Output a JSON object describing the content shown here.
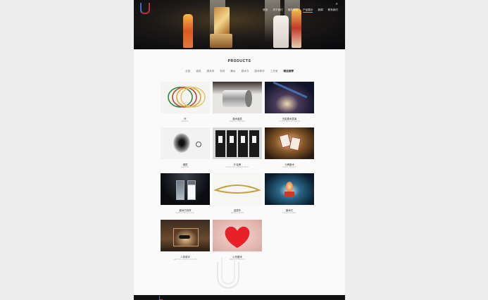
{
  "nav": {
    "items": [
      "首页",
      "关于我们",
      "服务项目",
      "产品展示",
      "新闻",
      "联系我们"
    ],
    "active_index": 3
  },
  "products": {
    "title": "PRODUCTS",
    "filters": [
      "全部",
      "道具",
      "魔术师",
      "特效",
      "舞台",
      "魔术书",
      "魔术教学",
      "工作室",
      "精选推荐"
    ],
    "active_filter_index": 8,
    "items": [
      {
        "name": "环",
        "sub": "RINGS",
        "thumb": "rings"
      },
      {
        "name": "魔术道具",
        "sub": "MAGIC PROPS",
        "thumb": "cylinder"
      },
      {
        "name": "光影魔术表演",
        "sub": "LIGHT MAGIC SHOW",
        "thumb": "light"
      },
      {
        "name": "烟雾",
        "sub": "SMOKE",
        "thumb": "smoke"
      },
      {
        "name": "扑克牌",
        "sub": "PLAYING CARDS BOX",
        "thumb": "cards"
      },
      {
        "name": "卡牌魔术",
        "sub": "CARD MAGIC",
        "thumb": "cardmagic"
      },
      {
        "name": "魔术牛奶杯",
        "sub": "MAGIC MILK CUP",
        "thumb": "glasses"
      },
      {
        "name": "金属环",
        "sub": "METAL RING",
        "thumb": "bangle"
      },
      {
        "name": "魔术灯",
        "sub": "MAGIC LAMP",
        "thumb": "lamp"
      },
      {
        "name": "人体悬浮",
        "sub": "LEVITATION ILLUSION",
        "thumb": "levitate"
      },
      {
        "name": "心形魔术",
        "sub": "HEART MAGIC",
        "thumb": "heart"
      }
    ]
  },
  "colors": {
    "accent": "#e84c2a",
    "page_bg": "#fafafa",
    "outer_bg": "#ededed"
  },
  "icons": {
    "search": "search-icon",
    "logo": "brand-logo"
  }
}
